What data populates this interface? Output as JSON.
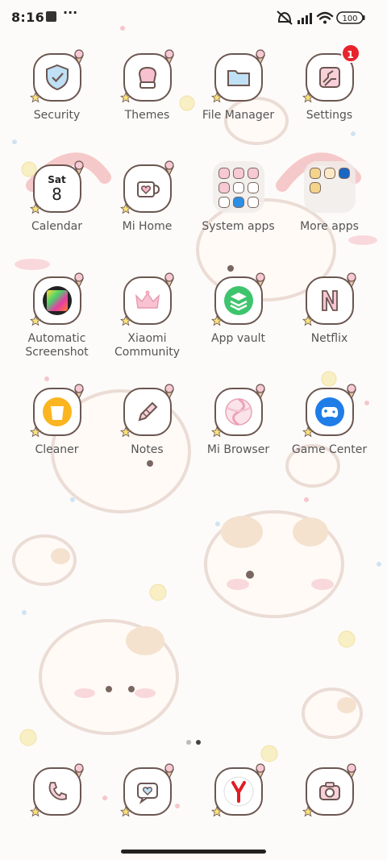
{
  "status_bar": {
    "time": "8:16",
    "dots": "···",
    "battery": "100"
  },
  "colors": {
    "badge": "#e8232b",
    "icon_outline": "#6b5650",
    "label": "#555555"
  },
  "apps": [
    {
      "label": "Security",
      "icon": "shield-icon"
    },
    {
      "label": "Themes",
      "icon": "paint-bucket-icon"
    },
    {
      "label": "File Manager",
      "icon": "folder-icon"
    },
    {
      "label": "Settings",
      "icon": "settings-icon",
      "badge": "1"
    },
    {
      "label": "Calendar",
      "icon": "calendar-icon",
      "day": "Sat",
      "date": "8"
    },
    {
      "label": "Mi Home",
      "icon": "mug-heart-icon"
    },
    {
      "label": "System apps",
      "icon": "folder-grid-icon"
    },
    {
      "label": "More apps",
      "icon": "folder-grid-icon"
    },
    {
      "label": "Automatic\nScreenshot",
      "icon": "screenshot-color-icon"
    },
    {
      "label": "Xiaomi\nCommunity",
      "icon": "crown-icon"
    },
    {
      "label": "App vault",
      "icon": "stack-layers-icon"
    },
    {
      "label": "Netflix",
      "icon": "netflix-n-icon"
    },
    {
      "label": "Cleaner",
      "icon": "trash-icon"
    },
    {
      "label": "Notes",
      "icon": "pencil-icon"
    },
    {
      "label": "Mi Browser",
      "icon": "browser-swirl-icon"
    },
    {
      "label": "Game Center",
      "icon": "gamepad-icon"
    }
  ],
  "dock": [
    {
      "icon": "phone-icon"
    },
    {
      "icon": "message-heart-icon"
    },
    {
      "icon": "yandex-browser-icon"
    },
    {
      "icon": "camera-icon"
    }
  ],
  "pager": {
    "pages": 2,
    "active": 1
  }
}
